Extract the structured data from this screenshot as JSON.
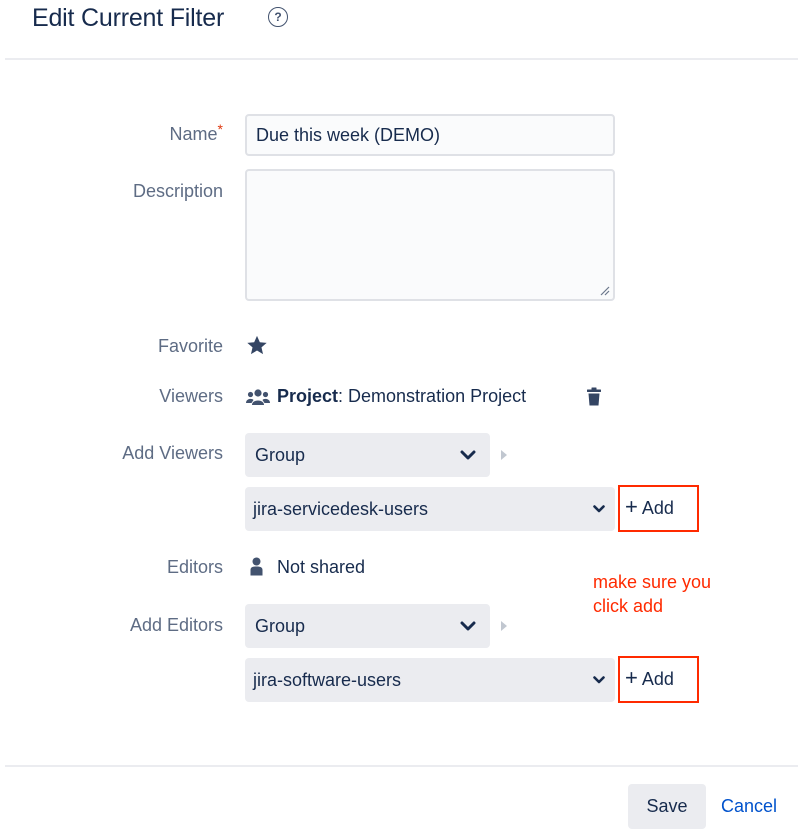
{
  "dialog": {
    "title": "Edit Current Filter",
    "help_icon": "help-circle-icon"
  },
  "form": {
    "name": {
      "label": "Name",
      "required_marker": "*",
      "value": "Due this week (DEMO)"
    },
    "description": {
      "label": "Description",
      "value": ""
    },
    "favorite": {
      "label": "Favorite",
      "icon": "star-icon",
      "starred": true
    },
    "viewers": {
      "label": "Viewers",
      "icon": "users-icon",
      "scope_bold": "Project",
      "scope_rest": ": Demonstration Project",
      "delete_icon": "trash-icon"
    },
    "add_viewers": {
      "label": "Add Viewers",
      "type_value": "Group",
      "group_value": "jira-servicedesk-users",
      "add_label": "Add",
      "add_icon": "plus-icon"
    },
    "editors": {
      "label": "Editors",
      "icon": "user-icon",
      "value": "Not shared"
    },
    "add_editors": {
      "label": "Add Editors",
      "type_value": "Group",
      "group_value": "jira-software-users",
      "add_label": "Add",
      "add_icon": "plus-icon"
    }
  },
  "annotation": {
    "line1": "make sure you",
    "line2": "click add",
    "color": "#ff2a00"
  },
  "footer": {
    "save_label": "Save",
    "cancel_label": "Cancel"
  },
  "colors": {
    "label": "#5e6c84",
    "text": "#172b4d",
    "link": "#0052cc",
    "required": "#de350b",
    "field_bg": "#fafbfc",
    "select_bg": "#ebecf0"
  }
}
